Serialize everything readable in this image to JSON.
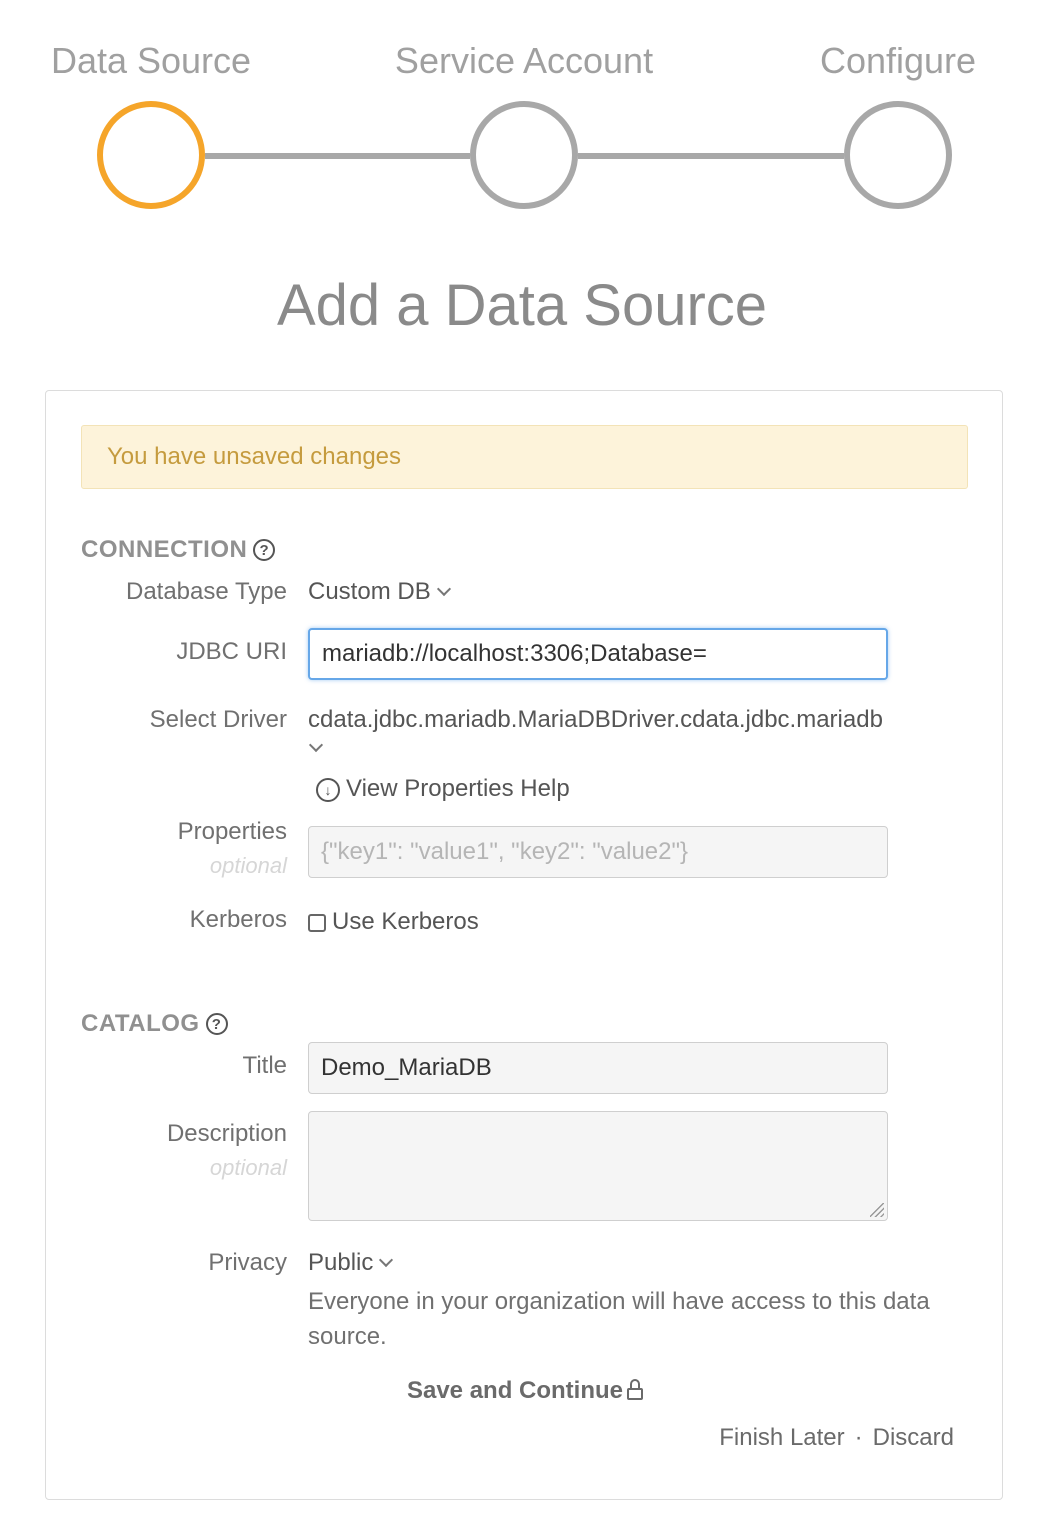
{
  "stepper": {
    "steps": [
      {
        "label": "Data Source",
        "state": "active"
      },
      {
        "label": "Service Account",
        "state": "pending"
      },
      {
        "label": "Configure",
        "state": "pending"
      }
    ],
    "active_color": "#f5a52a",
    "inactive_color": "#a8a8a8"
  },
  "page_title": "Add a Data Source",
  "banner": {
    "text": "You have unsaved changes",
    "background": "#fdf3da",
    "text_color": "#c59b3e"
  },
  "connection": {
    "section_title": "CONNECTION",
    "help_icon": "?",
    "database_type": {
      "label": "Database Type",
      "value": "Custom DB"
    },
    "jdbc_uri": {
      "label": "JDBC URI",
      "value": "mariadb://localhost:3306;Database="
    },
    "select_driver": {
      "label": "Select Driver",
      "value": "cdata.jdbc.mariadb.MariaDBDriver.cdata.jdbc.mariadb"
    },
    "view_properties_help": "View Properties Help",
    "properties": {
      "label": "Properties",
      "sublabel": "optional",
      "placeholder": "{\"key1\": \"value1\", \"key2\": \"value2\"}"
    },
    "kerberos": {
      "label": "Kerberos",
      "checkbox_label": "Use Kerberos",
      "checked": false
    }
  },
  "catalog": {
    "section_title": "CATALOG",
    "help_icon": "?",
    "title": {
      "label": "Title",
      "value": "Demo_MariaDB"
    },
    "description": {
      "label": "Description",
      "sublabel": "optional",
      "value": ""
    },
    "privacy": {
      "label": "Privacy",
      "value": "Public",
      "help_text": "Everyone in your organization will have access to this data source."
    }
  },
  "actions": {
    "save_continue": "Save and Continue",
    "finish_later": "Finish Later",
    "separator": "·",
    "discard": "Discard"
  },
  "icons": {
    "help": "help-circle-icon",
    "download": "download-circle-icon",
    "lock": "lock-icon",
    "chevron": "chevron-down-icon"
  }
}
